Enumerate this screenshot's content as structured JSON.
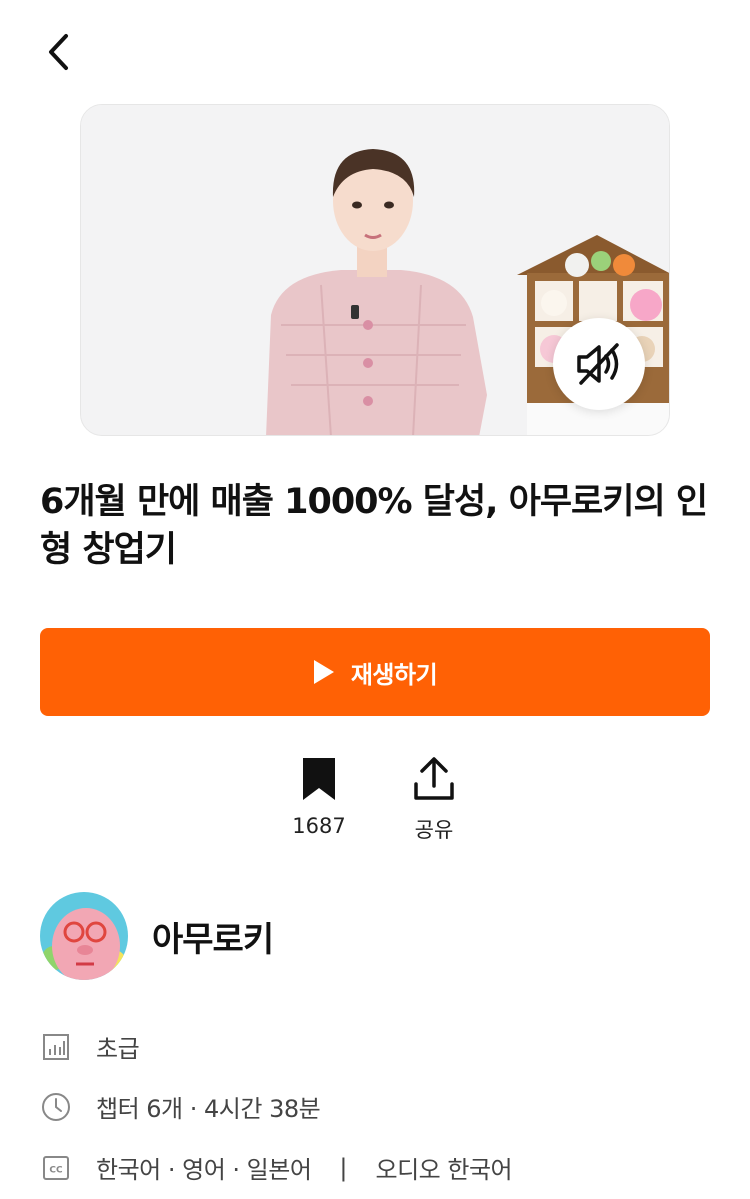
{
  "nav": {
    "back_icon": "chevron-left-icon"
  },
  "video": {
    "mute_icon": "speaker-muted-icon"
  },
  "course": {
    "title": "6개월 만에 매출 1000% 달성, 아무로키의 인형 창업기"
  },
  "play": {
    "label": "재생하기",
    "icon": "play-icon"
  },
  "actions": {
    "bookmark": {
      "icon": "bookmark-icon",
      "count": "1687"
    },
    "share": {
      "icon": "share-icon",
      "label": "공유"
    }
  },
  "creator": {
    "name": "아무로키"
  },
  "info": {
    "level": "초급",
    "duration": "챕터 6개 · 4시간 38분",
    "subtitles": "한국어 · 영어 · 일본어",
    "separator": "|",
    "audio": "오디오 한국어"
  },
  "colors": {
    "accent": "#ff6105"
  }
}
